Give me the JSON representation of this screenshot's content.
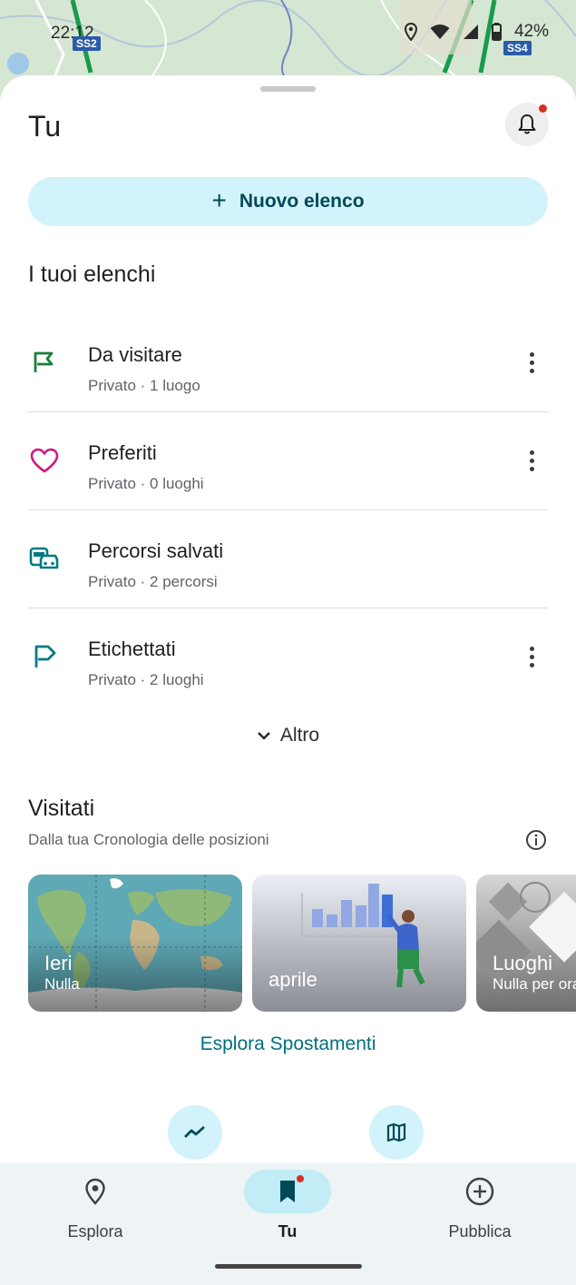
{
  "status_bar": {
    "time": "22:12",
    "battery": "42%",
    "shields": [
      "SS2",
      "SS4"
    ]
  },
  "header": {
    "title": "Tu"
  },
  "new_list_button": {
    "icon": "plus-icon",
    "label": "Nuovo elenco"
  },
  "lists_section": {
    "title": "I tuoi elenchi",
    "items": [
      {
        "name": "Da visitare",
        "sub": "Privato · 1 luogo",
        "icon": "flag-icon",
        "color": "#188038",
        "has_more": true
      },
      {
        "name": "Preferiti",
        "sub": "Privato · 0 luoghi",
        "icon": "heart-icon",
        "color": "#d01884",
        "has_more": true
      },
      {
        "name": "Percorsi salvati",
        "sub": "Privato · 2 percorsi",
        "icon": "transit-car-icon",
        "color": "#007b83",
        "has_more": false
      },
      {
        "name": "Etichettati",
        "sub": "Privato · 2 luoghi",
        "icon": "label-flag-icon",
        "color": "#007b83",
        "has_more": true
      }
    ],
    "more_label": "Altro"
  },
  "visited_section": {
    "title": "Visitati",
    "subtitle": "Dalla tua Cronologia delle posizioni",
    "cards": [
      {
        "title": "Ieri",
        "sub": "Nulla"
      },
      {
        "title": "aprile",
        "sub": ""
      },
      {
        "title": "Luoghi",
        "sub": "Nulla per ora"
      }
    ],
    "explore_link": "Esplora Spostamenti"
  },
  "fabs": [
    {
      "icon": "trending-icon"
    },
    {
      "icon": "map-icon"
    }
  ],
  "bottom_nav": {
    "items": [
      {
        "label": "Esplora",
        "icon": "location-pin-icon",
        "active": false
      },
      {
        "label": "Tu",
        "icon": "bookmark-icon",
        "active": true
      },
      {
        "label": "Pubblica",
        "icon": "add-circle-icon",
        "active": false
      }
    ]
  },
  "colors": {
    "accent": "#00707c",
    "pill_bg": "#d3f3fc",
    "nav_bg": "#eef3f5",
    "badge_red": "#d93025"
  }
}
